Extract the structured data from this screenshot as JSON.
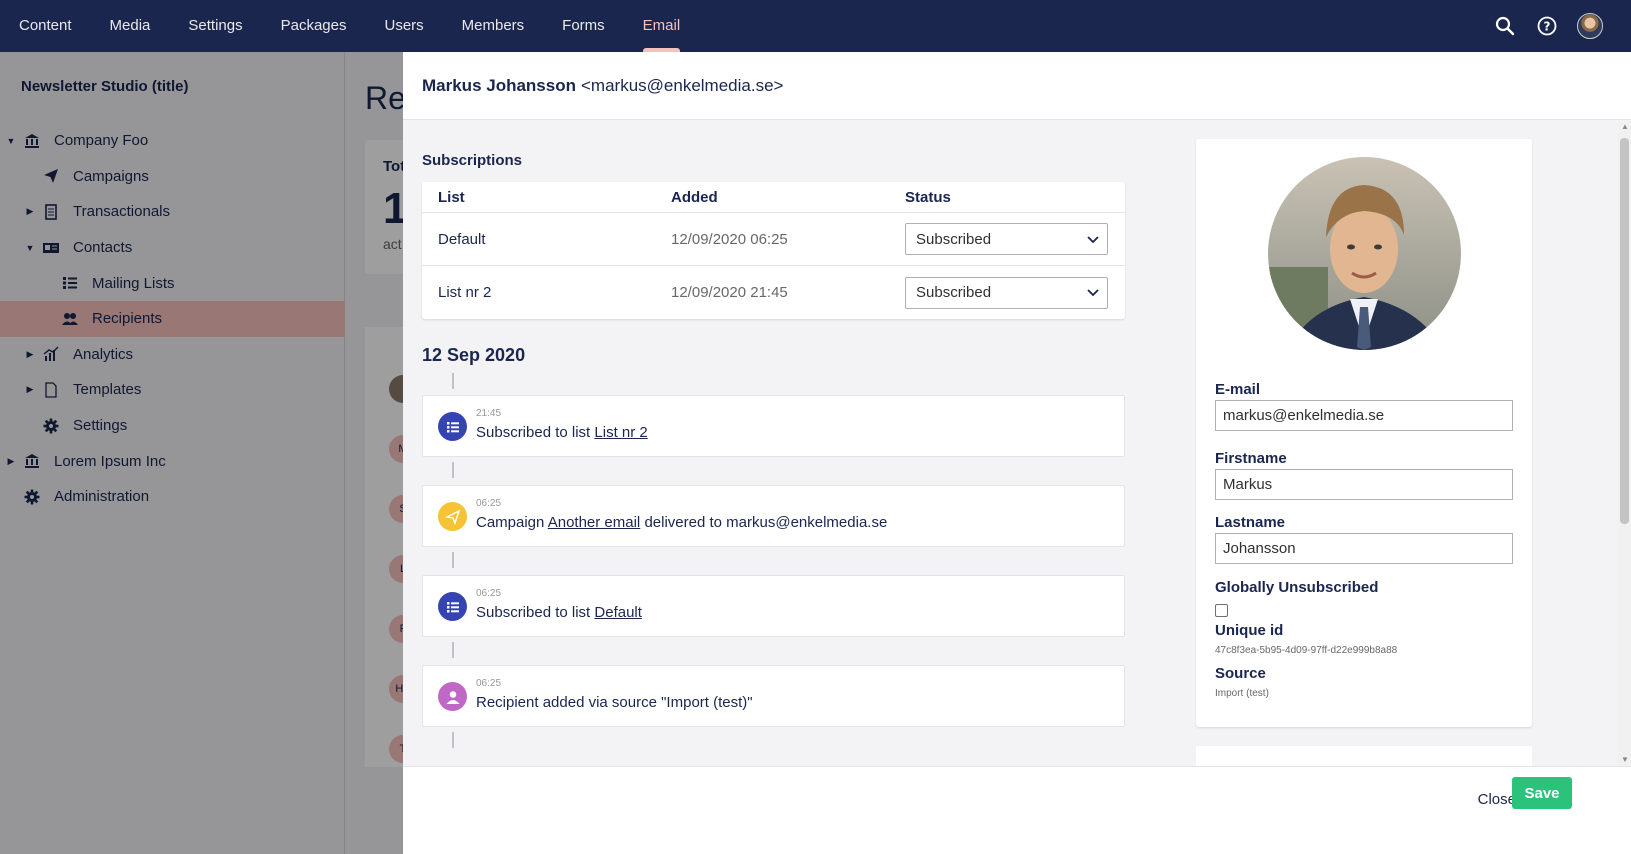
{
  "topnav": {
    "items": [
      "Content",
      "Media",
      "Settings",
      "Packages",
      "Users",
      "Members",
      "Forms",
      "Email"
    ],
    "active": "Email"
  },
  "sidebar": {
    "title": "Newsletter Studio (title)",
    "tree": [
      {
        "label": "Company Foo",
        "icon": "institution-icon",
        "level": 0,
        "caret": "down"
      },
      {
        "label": "Campaigns",
        "icon": "paper-plane-icon",
        "level": 1,
        "caret": ""
      },
      {
        "label": "Transactionals",
        "icon": "receipt-icon",
        "level": 1,
        "caret": "right"
      },
      {
        "label": "Contacts",
        "icon": "id-card-icon",
        "level": 1,
        "caret": "down"
      },
      {
        "label": "Mailing Lists",
        "icon": "list-icon",
        "level": 2,
        "caret": ""
      },
      {
        "label": "Recipients",
        "icon": "users-icon",
        "level": 2,
        "caret": "",
        "selected": true
      },
      {
        "label": "Analytics",
        "icon": "chart-icon",
        "level": 1,
        "caret": "right"
      },
      {
        "label": "Templates",
        "icon": "document-icon",
        "level": 1,
        "caret": "right"
      },
      {
        "label": "Settings",
        "icon": "gear-icon",
        "level": 1,
        "caret": ""
      },
      {
        "label": "Lorem Ipsum Inc",
        "icon": "institution-icon",
        "level": 0,
        "caret": "right"
      },
      {
        "label": "Administration",
        "icon": "gear-icon",
        "level": 0,
        "caret": ""
      }
    ]
  },
  "background": {
    "title": "Re",
    "card_label": "Tot",
    "card_value": "1",
    "card_sub": "act",
    "bubbles": [
      "",
      "M",
      "S",
      "L",
      "F",
      "HV",
      "T"
    ]
  },
  "panel": {
    "name": "Markus Johansson",
    "email_display": "<markus@enkelmedia.se>",
    "subscriptions_title": "Subscriptions",
    "subs_headers": {
      "list": "List",
      "added": "Added",
      "status": "Status"
    },
    "subscriptions": [
      {
        "list": "Default",
        "added": "12/09/2020 06:25",
        "status": "Subscribed"
      },
      {
        "list": "List nr 2",
        "added": "12/09/2020 21:45",
        "status": "Subscribed"
      }
    ],
    "timeline_date": "12 Sep 2020",
    "timeline": [
      {
        "time": "21:45",
        "pre": "Subscribed to list ",
        "link": "List nr 2",
        "post": "",
        "color": "#3544b1"
      },
      {
        "time": "06:25",
        "pre": "Campaign ",
        "link": "Another email",
        "post": " delivered to markus@enkelmedia.se",
        "color": "#f5c335"
      },
      {
        "time": "06:25",
        "pre": "Subscribed to list ",
        "link": "Default",
        "post": "",
        "color": "#3544b1"
      },
      {
        "time": "06:25",
        "pre": "Recipient added via source \"Import (test)\"",
        "link": "",
        "post": "",
        "color": "#c068c6"
      }
    ],
    "details": {
      "email_label": "E-mail",
      "email_value": "markus@enkelmedia.se",
      "firstname_label": "Firstname",
      "firstname_value": "Markus",
      "lastname_label": "Lastname",
      "lastname_value": "Johansson",
      "unsub_label": "Globally Unsubscribed",
      "uid_label": "Unique id",
      "uid_value": "47c8f3ea-5b95-4d09-97ff-d22e999b8a88",
      "source_label": "Source",
      "source_value": "Import (test)"
    },
    "close_label": "Close",
    "save_label": "Save"
  },
  "colors": {
    "nav_bg": "#1b264f",
    "active": "#f5c1bc",
    "save": "#2bc37c"
  }
}
